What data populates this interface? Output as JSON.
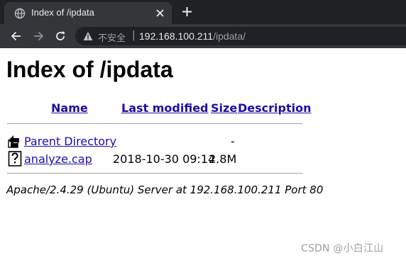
{
  "browser": {
    "tab_title": "Index of /ipdata",
    "security_label": "不安全",
    "separator": "|",
    "url_host": "192.168.100.211",
    "url_path": "/ipdata/"
  },
  "page": {
    "title": "Index of /ipdata",
    "columns": {
      "name": "Name",
      "last_modified": "Last modified",
      "size": "Size",
      "description": "Description"
    },
    "rows": [
      {
        "name": "Parent Directory",
        "last_modified": "",
        "size": "-",
        "icon": "back-folder-icon"
      },
      {
        "name": "analyze.cap",
        "last_modified": "2018-10-30 09:14",
        "size": "2.8M",
        "icon": "unknown-file-icon"
      }
    ],
    "address": "Apache/2.4.29 (Ubuntu) Server at 192.168.100.211 Port 80"
  },
  "watermark": "CSDN @小白江山",
  "colors": {
    "chrome_dark": "#202124",
    "chrome_tab": "#35363a",
    "link": "#1a0dab"
  }
}
